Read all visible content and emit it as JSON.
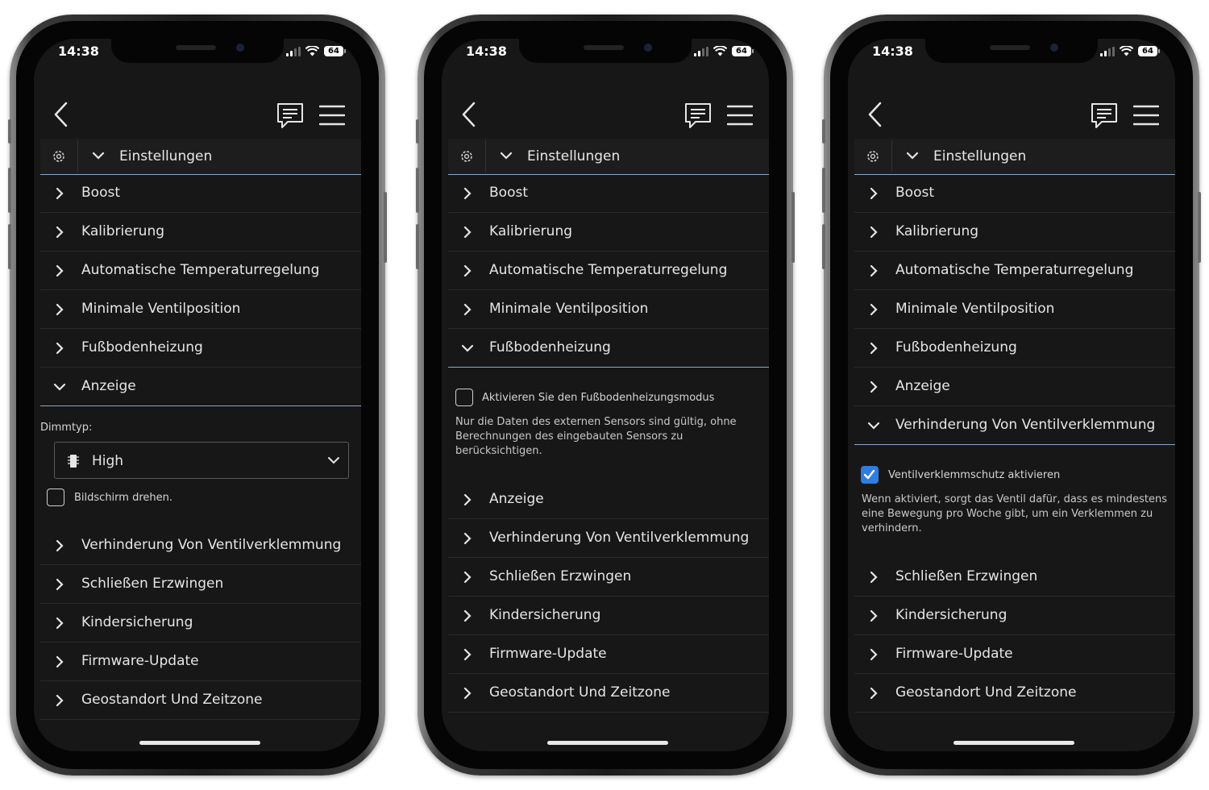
{
  "status_bar": {
    "time": "14:38",
    "battery": "64"
  },
  "section": {
    "title": "Einstellungen"
  },
  "menu": {
    "boost": "Boost",
    "kalibrierung": "Kalibrierung",
    "auto_temp": "Automatische Temperaturregelung",
    "min_ventil": "Minimale Ventilposition",
    "fussboden": "Fußbodenheizung",
    "anzeige": "Anzeige",
    "verhinderung": "Verhinderung Von Ventilverklemmung",
    "schliessen": "Schließen Erzwingen",
    "kindersicherung": "Kindersicherung",
    "firmware": "Firmware-Update",
    "geostandort": "Geostandort Und Zeitzone"
  },
  "anzeige_panel": {
    "dimm_label": "Dimmtyp:",
    "dimm_value": "High",
    "rotate_label": "Bildschirm drehen."
  },
  "fussboden_panel": {
    "checkbox_label": "Aktivieren Sie den Fußbodenheizungsmodus",
    "desc_line1": "Nur die Daten des externen Sensors sind gültig, ohne",
    "desc_line2": "Berechnungen des eingebauten Sensors zu",
    "desc_line3": "berücksichtigen."
  },
  "ventil_panel": {
    "checkbox_label": "Ventilverklemmschutz aktivieren",
    "desc_line1": "Wenn aktiviert, sorgt das Ventil dafür, dass es mindestens",
    "desc_line2": "eine Bewegung pro Woche gibt, um ein Verklemmen zu",
    "desc_line3": "verhindern."
  },
  "colors": {
    "accent_line": "#8aa7c9",
    "checkbox_checked": "#2f7de0",
    "screen_bg": "#171717"
  }
}
